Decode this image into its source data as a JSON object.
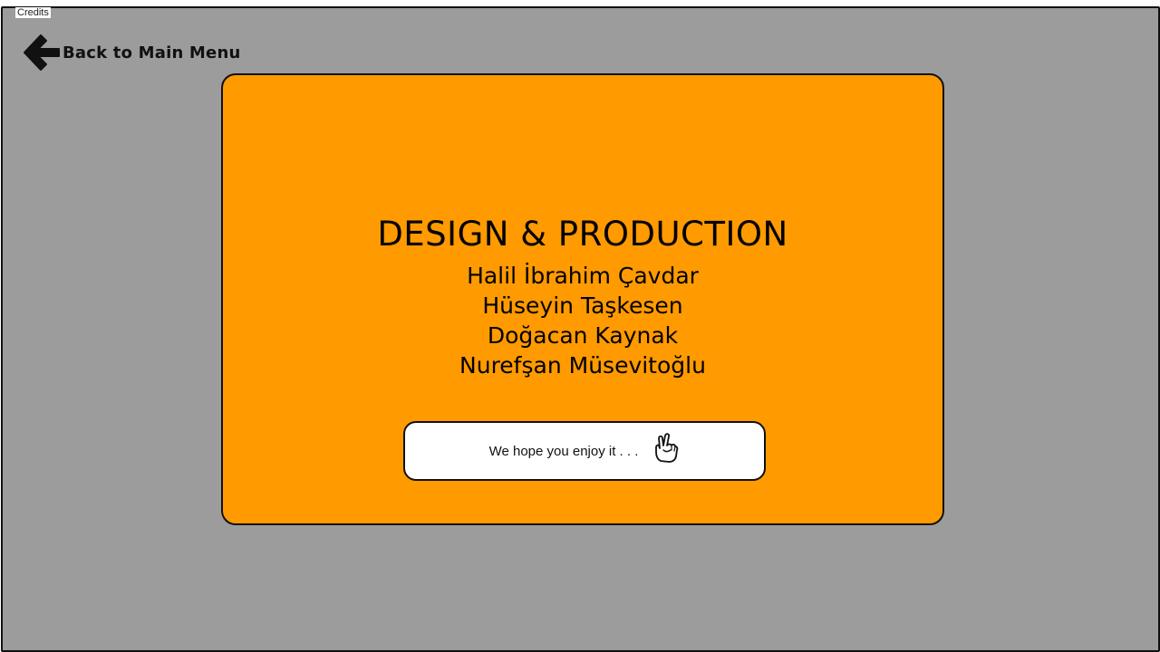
{
  "window": {
    "title": "Credits"
  },
  "navigation": {
    "back_label": "Back to Main Menu",
    "back_icon": "arrow-left-icon"
  },
  "credits": {
    "heading": "DESIGN & PRODUCTION",
    "names": [
      "Halil İbrahim Çavdar",
      "Hüseyin Taşkesen",
      "Doğacan Kaynak",
      "Nurefşan Müsevitoğlu"
    ],
    "message": "We hope you enjoy it . . .",
    "message_icon": "victory-hand-icon"
  },
  "colors": {
    "background": "#9c9c9c",
    "card": "#ff9a00",
    "outline": "#111111",
    "message_box": "#ffffff"
  }
}
